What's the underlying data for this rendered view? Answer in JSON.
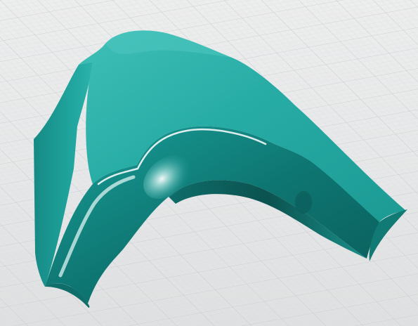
{
  "viewport": {
    "background": "#e9eaeb",
    "grid_color": "#c9cbcd",
    "grid_minor_color": "#d8dadb"
  },
  "model": {
    "surface_color": "#1fa6a0",
    "surface_dark": "#0a5f5c",
    "surface_light": "#54cdc6",
    "highlight": "#ffffff",
    "icon": "ridge-tile-3d-model"
  }
}
